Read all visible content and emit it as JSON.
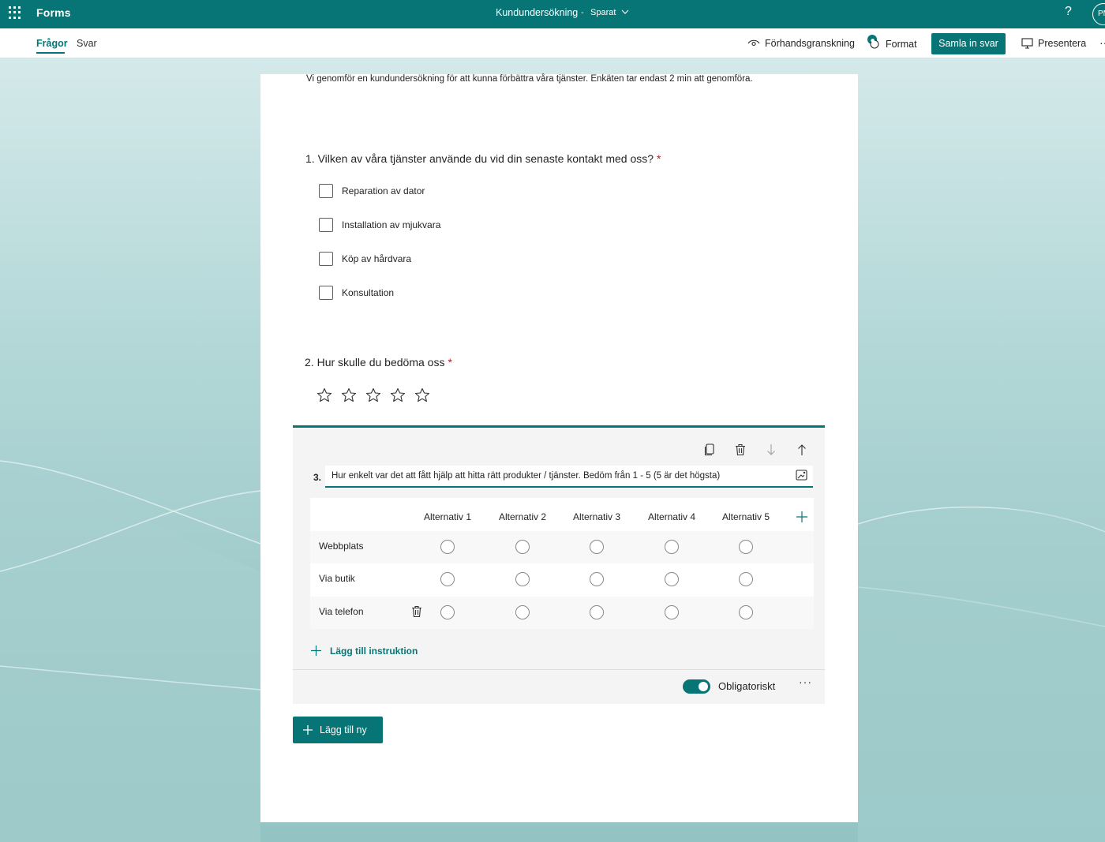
{
  "app": {
    "name": "Forms"
  },
  "document": {
    "title": "Kundundersökning",
    "separator": "-",
    "status": "Sparat"
  },
  "topbar": {
    "help": "?",
    "avatar_initials": "PM"
  },
  "tabs": [
    {
      "label": "Frågor",
      "active": true
    },
    {
      "label": "Svar",
      "active": false
    }
  ],
  "commands": {
    "preview": "Förhandsgranskning",
    "format": "Format",
    "collect": "Samla in svar",
    "present": "Presentera",
    "more": "···"
  },
  "form": {
    "description": "Vi genomför en kundundersökning för att kunna förbättra våra tjänster. Enkäten tar endast 2 min att genomföra.",
    "questions": [
      {
        "number": "1.",
        "title": "Vilken av våra tjänster använde du vid din senaste kontakt med oss?",
        "required": "*",
        "type": "choice",
        "options": [
          "Reparation av dator",
          "Installation av mjukvara",
          "Köp av hårdvara",
          "Konsultation"
        ]
      },
      {
        "number": "2.",
        "title": "Hur skulle du bedöma oss",
        "required": "*",
        "type": "rating",
        "stars": 5
      },
      {
        "number": "3.",
        "title": "Hur enkelt var det att fått hjälp att hitta rätt produkter / tjänster. Bedöm från 1 - 5 (5 är det högsta)",
        "type": "likert",
        "columns": [
          "Alternativ 1",
          "Alternativ 2",
          "Alternativ 3",
          "Alternativ 4",
          "Alternativ 5"
        ],
        "rows": [
          "Webbplats",
          "Via butik",
          "Via telefon"
        ],
        "add_instruction": "Lägg till instruktion",
        "required_label": "Obligatoriskt",
        "required_on": true,
        "more": "···"
      }
    ],
    "add_new": "Lägg till ny"
  },
  "colors": {
    "accent": "#077575",
    "required": "#a4262c"
  }
}
